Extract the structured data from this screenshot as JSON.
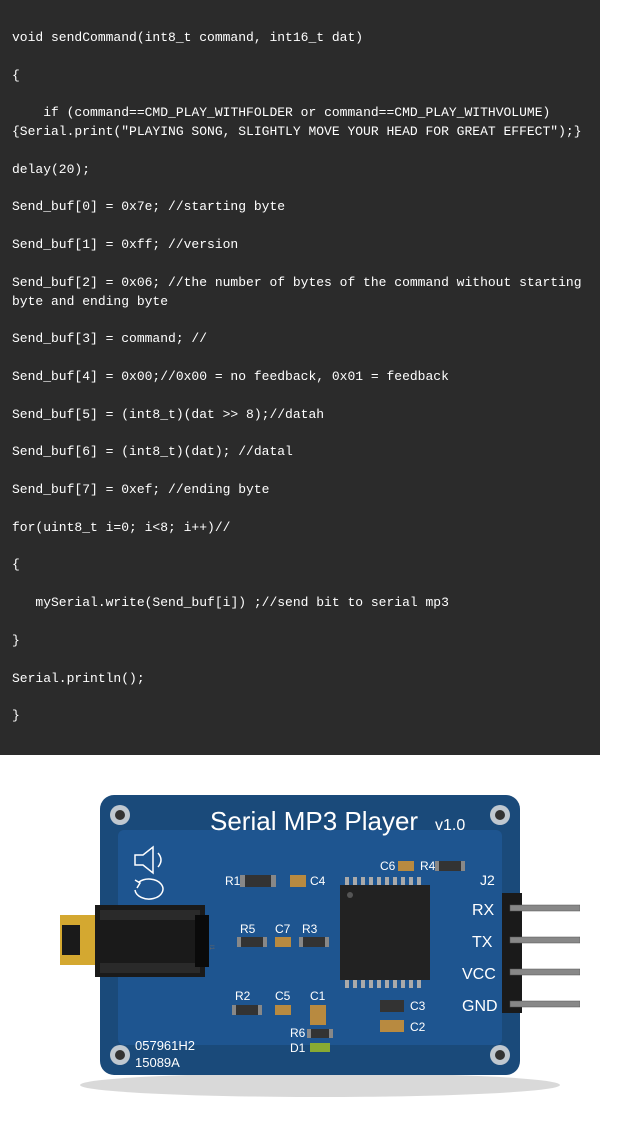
{
  "code": {
    "l0": "void sendCommand(int8_t command, int16_t dat)",
    "l1": "{",
    "l2": "    if (command==CMD_PLAY_WITHFOLDER or command==CMD_PLAY_WITHVOLUME){Serial.print(\"PLAYING SONG, SLIGHTLY MOVE YOUR HEAD FOR GREAT EFFECT\");}",
    "l3": "delay(20);",
    "l4": "Send_buf[0] = 0x7e; //starting byte",
    "l5": "Send_buf[1] = 0xff; //version",
    "l6": "Send_buf[2] = 0x06; //the number of bytes of the command without starting byte and ending byte",
    "l7": "Send_buf[3] = command; //",
    "l8": "Send_buf[4] = 0x00;//0x00 = no feedback, 0x01 = feedback",
    "l9": "Send_buf[5] = (int8_t)(dat >> 8);//datah",
    "l10": "Send_buf[6] = (int8_t)(dat); //datal",
    "l11": "Send_buf[7] = 0xef; //ending byte",
    "l12": "for(uint8_t i=0; i<8; i++)//",
    "l13": "{",
    "l14": "   mySerial.write(Send_buf[i]) ;//send bit to serial mp3",
    "l15": "}",
    "l16": "Serial.println();",
    "l17": "}"
  },
  "board": {
    "title": "Serial MP3 Player",
    "version": "v1.0",
    "labels": {
      "r1": "R1",
      "c4": "C4",
      "c6": "C6",
      "r4": "R4",
      "r5": "R5",
      "c7": "C7",
      "r3": "R3",
      "r2": "R2",
      "c5": "C5",
      "c1": "C1",
      "c3": "C3",
      "r6": "R6",
      "d1": "D1",
      "c2": "C2",
      "j2": "J2",
      "rx": "RX",
      "tx": "TX",
      "vcc": "VCC",
      "gnd": "GND",
      "partno1": "057961H2",
      "partno2": "15089A"
    }
  }
}
